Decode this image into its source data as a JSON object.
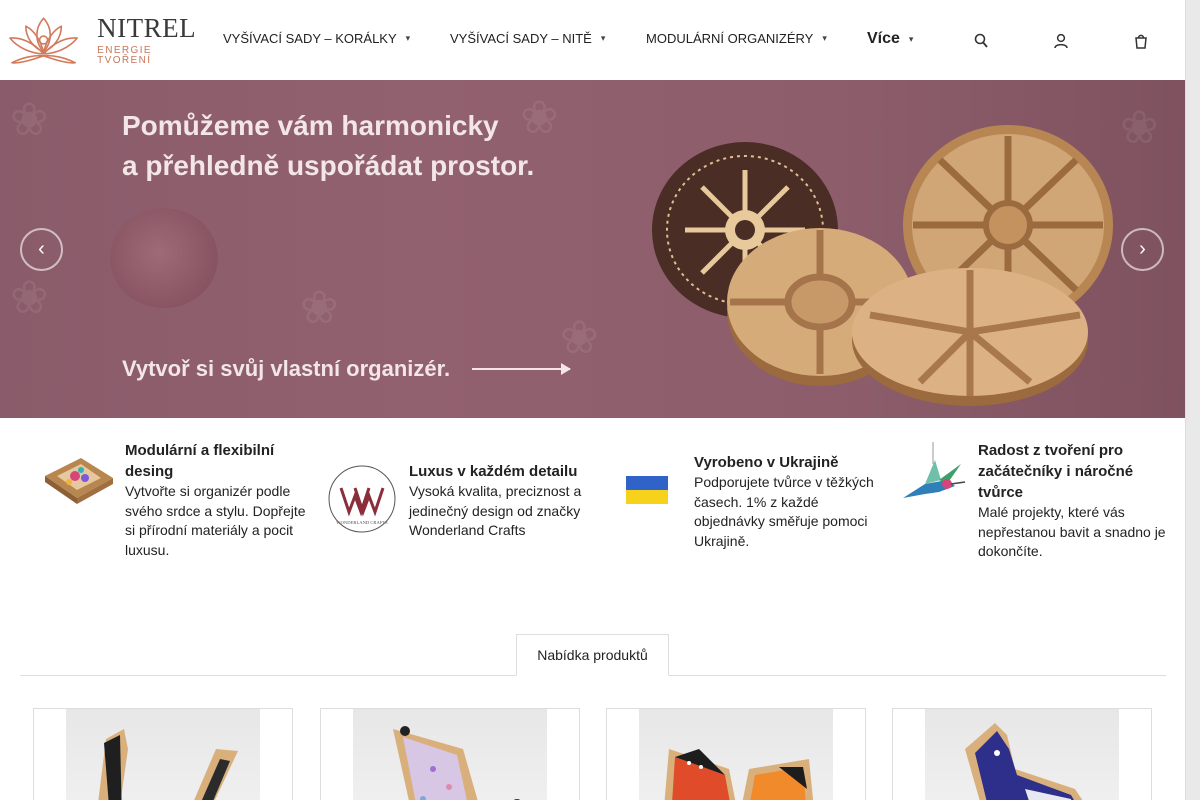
{
  "header": {
    "logo": {
      "name": "NITREL",
      "tagline": "ENERGIE TVOŘENÍ"
    },
    "nav": [
      {
        "label": "VYŠÍVACÍ SADY – KORÁLKY"
      },
      {
        "label": "VYŠÍVACÍ SADY – NITĚ"
      },
      {
        "label": "MODULÁRNÍ ORGANIZÉRY"
      }
    ],
    "more_label": "Více",
    "icons": [
      "search-icon",
      "user-icon",
      "cart-icon"
    ]
  },
  "hero": {
    "headline_line1": "Pomůžeme vám harmonicky",
    "headline_line2": "a přehledně uspořádat prostor.",
    "cta": "Vytvoř si svůj vlastní organizér.",
    "prev_icon": "chevron-left-icon",
    "next_icon": "chevron-right-icon"
  },
  "features": [
    {
      "title": "Modulární a flexibilní desing",
      "desc": "Vytvořte si organizér podle svého srdce a stylu. Dopřejte si přírodní materiály a pocit luxusu."
    },
    {
      "title": "Luxus v každém detailu",
      "desc": "Vysoká kvalita, preciznost a jedinečný design od značky Wonderland Crafts",
      "logo_text": "WONDERLAND CRAFTS"
    },
    {
      "title": "Vyrobeno v Ukrajině",
      "desc": "Podporujete tvůrce v těžkých časech. 1% z každé objednávky směřuje pomoci Ukrajině."
    },
    {
      "title": "Radost z tvoření pro začátečníky i náročné tvůrce",
      "desc": "Malé projekty, které vás nepřestanou bavit a snadno je dokončíte."
    }
  ],
  "tabs": [
    {
      "label": "Nabídka produktů"
    }
  ],
  "colors": {
    "brand_orange": "#d27a5c",
    "hero_bg": "#8e5e6c",
    "ukraine_blue": "#2f63c8",
    "ukraine_yellow": "#f7d21c"
  }
}
